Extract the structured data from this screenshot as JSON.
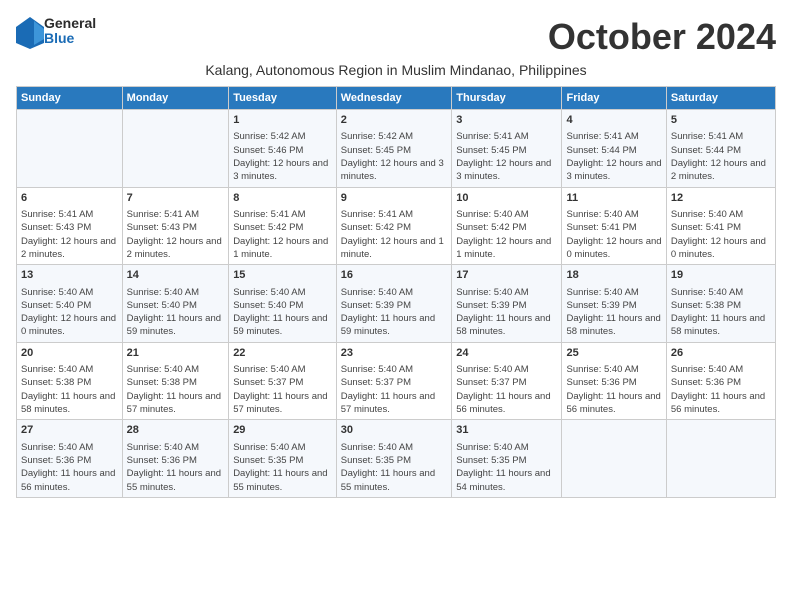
{
  "header": {
    "logo_line1": "General",
    "logo_line2": "Blue",
    "month_title": "October 2024",
    "subtitle": "Kalang, Autonomous Region in Muslim Mindanao, Philippines"
  },
  "days_of_week": [
    "Sunday",
    "Monday",
    "Tuesday",
    "Wednesday",
    "Thursday",
    "Friday",
    "Saturday"
  ],
  "weeks": [
    [
      {
        "day": "",
        "info": ""
      },
      {
        "day": "",
        "info": ""
      },
      {
        "day": "1",
        "info": "Sunrise: 5:42 AM\nSunset: 5:46 PM\nDaylight: 12 hours and 3 minutes."
      },
      {
        "day": "2",
        "info": "Sunrise: 5:42 AM\nSunset: 5:45 PM\nDaylight: 12 hours and 3 minutes."
      },
      {
        "day": "3",
        "info": "Sunrise: 5:41 AM\nSunset: 5:45 PM\nDaylight: 12 hours and 3 minutes."
      },
      {
        "day": "4",
        "info": "Sunrise: 5:41 AM\nSunset: 5:44 PM\nDaylight: 12 hours and 3 minutes."
      },
      {
        "day": "5",
        "info": "Sunrise: 5:41 AM\nSunset: 5:44 PM\nDaylight: 12 hours and 2 minutes."
      }
    ],
    [
      {
        "day": "6",
        "info": "Sunrise: 5:41 AM\nSunset: 5:43 PM\nDaylight: 12 hours and 2 minutes."
      },
      {
        "day": "7",
        "info": "Sunrise: 5:41 AM\nSunset: 5:43 PM\nDaylight: 12 hours and 2 minutes."
      },
      {
        "day": "8",
        "info": "Sunrise: 5:41 AM\nSunset: 5:42 PM\nDaylight: 12 hours and 1 minute."
      },
      {
        "day": "9",
        "info": "Sunrise: 5:41 AM\nSunset: 5:42 PM\nDaylight: 12 hours and 1 minute."
      },
      {
        "day": "10",
        "info": "Sunrise: 5:40 AM\nSunset: 5:42 PM\nDaylight: 12 hours and 1 minute."
      },
      {
        "day": "11",
        "info": "Sunrise: 5:40 AM\nSunset: 5:41 PM\nDaylight: 12 hours and 0 minutes."
      },
      {
        "day": "12",
        "info": "Sunrise: 5:40 AM\nSunset: 5:41 PM\nDaylight: 12 hours and 0 minutes."
      }
    ],
    [
      {
        "day": "13",
        "info": "Sunrise: 5:40 AM\nSunset: 5:40 PM\nDaylight: 12 hours and 0 minutes."
      },
      {
        "day": "14",
        "info": "Sunrise: 5:40 AM\nSunset: 5:40 PM\nDaylight: 11 hours and 59 minutes."
      },
      {
        "day": "15",
        "info": "Sunrise: 5:40 AM\nSunset: 5:40 PM\nDaylight: 11 hours and 59 minutes."
      },
      {
        "day": "16",
        "info": "Sunrise: 5:40 AM\nSunset: 5:39 PM\nDaylight: 11 hours and 59 minutes."
      },
      {
        "day": "17",
        "info": "Sunrise: 5:40 AM\nSunset: 5:39 PM\nDaylight: 11 hours and 58 minutes."
      },
      {
        "day": "18",
        "info": "Sunrise: 5:40 AM\nSunset: 5:39 PM\nDaylight: 11 hours and 58 minutes."
      },
      {
        "day": "19",
        "info": "Sunrise: 5:40 AM\nSunset: 5:38 PM\nDaylight: 11 hours and 58 minutes."
      }
    ],
    [
      {
        "day": "20",
        "info": "Sunrise: 5:40 AM\nSunset: 5:38 PM\nDaylight: 11 hours and 58 minutes."
      },
      {
        "day": "21",
        "info": "Sunrise: 5:40 AM\nSunset: 5:38 PM\nDaylight: 11 hours and 57 minutes."
      },
      {
        "day": "22",
        "info": "Sunrise: 5:40 AM\nSunset: 5:37 PM\nDaylight: 11 hours and 57 minutes."
      },
      {
        "day": "23",
        "info": "Sunrise: 5:40 AM\nSunset: 5:37 PM\nDaylight: 11 hours and 57 minutes."
      },
      {
        "day": "24",
        "info": "Sunrise: 5:40 AM\nSunset: 5:37 PM\nDaylight: 11 hours and 56 minutes."
      },
      {
        "day": "25",
        "info": "Sunrise: 5:40 AM\nSunset: 5:36 PM\nDaylight: 11 hours and 56 minutes."
      },
      {
        "day": "26",
        "info": "Sunrise: 5:40 AM\nSunset: 5:36 PM\nDaylight: 11 hours and 56 minutes."
      }
    ],
    [
      {
        "day": "27",
        "info": "Sunrise: 5:40 AM\nSunset: 5:36 PM\nDaylight: 11 hours and 56 minutes."
      },
      {
        "day": "28",
        "info": "Sunrise: 5:40 AM\nSunset: 5:36 PM\nDaylight: 11 hours and 55 minutes."
      },
      {
        "day": "29",
        "info": "Sunrise: 5:40 AM\nSunset: 5:35 PM\nDaylight: 11 hours and 55 minutes."
      },
      {
        "day": "30",
        "info": "Sunrise: 5:40 AM\nSunset: 5:35 PM\nDaylight: 11 hours and 55 minutes."
      },
      {
        "day": "31",
        "info": "Sunrise: 5:40 AM\nSunset: 5:35 PM\nDaylight: 11 hours and 54 minutes."
      },
      {
        "day": "",
        "info": ""
      },
      {
        "day": "",
        "info": ""
      }
    ]
  ]
}
